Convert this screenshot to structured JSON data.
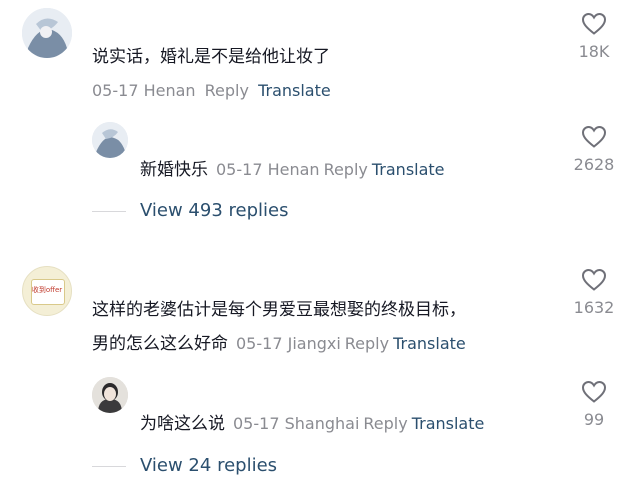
{
  "comments": [
    {
      "text_lines": [
        "说实话，婚礼是不是给他让妆了"
      ],
      "date": "05-17",
      "location": "Henan",
      "likes": "18K",
      "reply": {
        "text": "新婚快乐",
        "date": "05-17",
        "location": "Henan",
        "likes": "2628"
      },
      "view_replies": "View 493 replies"
    },
    {
      "avatar_text": "收到offer",
      "text_lines": [
        "这样的老婆估计是每个男爱豆最想娶的终极目标，",
        "男的怎么这么好命"
      ],
      "date": "05-17",
      "location": "Jiangxi",
      "likes": "1632",
      "reply": {
        "text": "为啥这么说",
        "date": "05-17",
        "location": "Shanghai",
        "likes": "99"
      },
      "view_replies": "View 24 replies"
    }
  ],
  "labels": {
    "reply": "Reply",
    "translate": "Translate"
  },
  "icons": {
    "like": "heart-outline-icon"
  },
  "colors": {
    "text": "#161823",
    "meta": "#8a8b91",
    "link": "#2b4f6e"
  }
}
